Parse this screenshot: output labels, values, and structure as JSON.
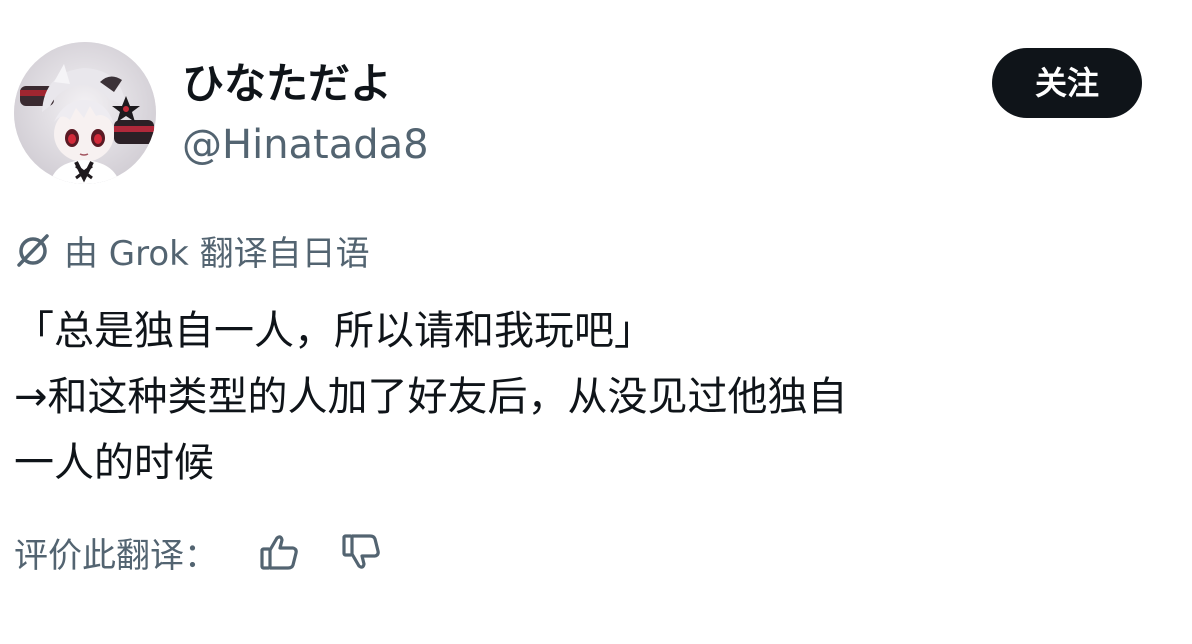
{
  "user": {
    "display_name": "ひなただよ",
    "handle": "@Hinatada8",
    "avatar_icon": "anime-avatar-icon"
  },
  "follow_button": {
    "label": "关注"
  },
  "translation": {
    "icon": "grok-icon",
    "label": "由 Grok 翻译自日语"
  },
  "tweet": {
    "lines": [
      "「总是独自一人，所以请和我玩吧」",
      "→和这种类型的人加了好友后，从没见过他独自",
      "一人的时候"
    ]
  },
  "rating": {
    "label": "评价此翻译：",
    "thumbs_up_icon": "thumbs-up-icon",
    "thumbs_down_icon": "thumbs-down-icon"
  },
  "colors": {
    "text_primary": "#0f1419",
    "text_secondary": "#536471",
    "button_bg": "#0f1419",
    "button_text": "#ffffff"
  }
}
